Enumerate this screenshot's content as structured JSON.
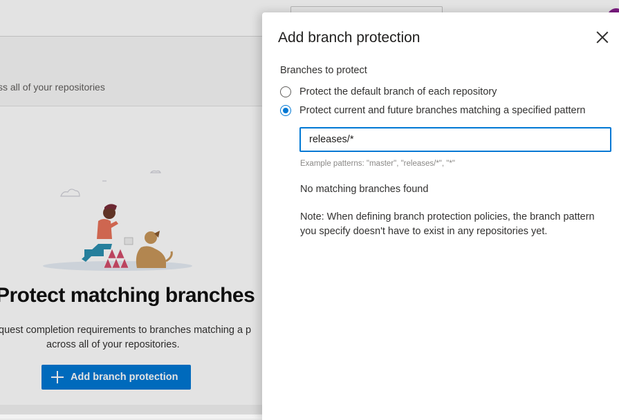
{
  "background": {
    "subtitle": "ss all of your repositories",
    "empty_state": {
      "heading": "Protect matching branches",
      "description_line1": "quest completion requirements to branches matching a p",
      "description_line2": "across all of your repositories.",
      "add_button_label": "Add branch protection"
    }
  },
  "panel": {
    "title": "Add branch protection",
    "section_label": "Branches to protect",
    "options": [
      {
        "label": "Protect the default branch of each repository",
        "selected": false
      },
      {
        "label": "Protect current and future branches matching a specified pattern",
        "selected": true
      }
    ],
    "pattern_input": {
      "value": "releases/*"
    },
    "example_text": "Example patterns: \"master\", \"releases/*\", \"*\"",
    "no_match_text": "No matching branches found",
    "note_text": "Note: When defining branch protection policies, the branch pattern you specify doesn't have to exist in any repositories yet."
  },
  "colors": {
    "accent": "#0078d4",
    "avatar": "#8a1f8f"
  }
}
